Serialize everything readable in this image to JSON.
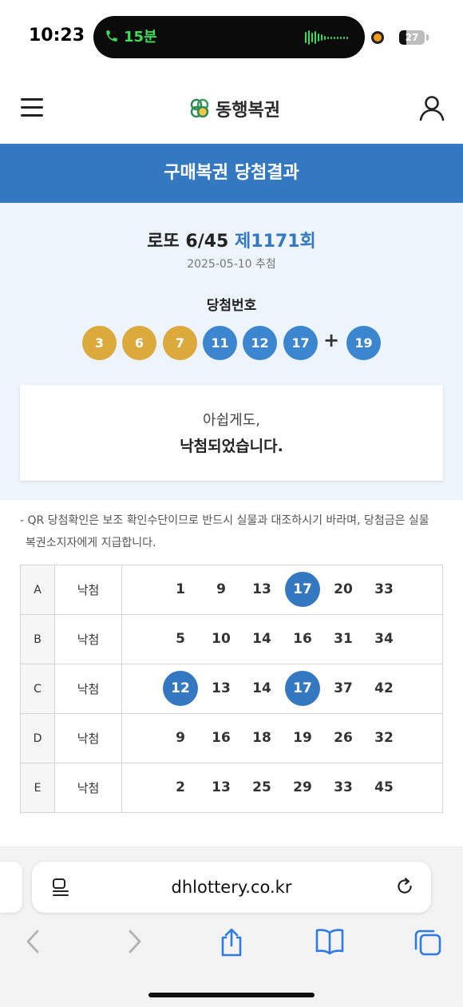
{
  "status_bar": {
    "time": "10:23",
    "call_duration": "15분",
    "battery_level": "27",
    "battery_fraction": 0.27
  },
  "header": {
    "logo_text": "동행복권",
    "menu_icon": "menu-icon",
    "user_icon": "user-icon"
  },
  "page": {
    "title": "구매복권 당첨결과"
  },
  "draw": {
    "game_name": "로또 6/45",
    "round": "제1171회",
    "date": "2025-05-10 추첨",
    "numbers_label": "당첨번호",
    "winning_numbers": [
      "3",
      "6",
      "7",
      "11",
      "12",
      "17"
    ],
    "plus": "+",
    "bonus_number": "19"
  },
  "result_message": {
    "line1": "아쉽게도,",
    "line2": "낙첨되었습니다."
  },
  "notice": {
    "line1": "- QR 당첨확인은 보조 확인수단이므로 반드시 실물과 대조하시기 바라며, 당첨금은 실물",
    "line2": "복권소지자에게 지급합니다."
  },
  "tickets": [
    {
      "game": "A",
      "result": "낙첨",
      "numbers": [
        "1",
        "9",
        "13",
        "17",
        "20",
        "33"
      ],
      "matched": [
        false,
        false,
        false,
        true,
        false,
        false
      ]
    },
    {
      "game": "B",
      "result": "낙첨",
      "numbers": [
        "5",
        "10",
        "14",
        "16",
        "31",
        "34"
      ],
      "matched": [
        false,
        false,
        false,
        false,
        false,
        false
      ]
    },
    {
      "game": "C",
      "result": "낙첨",
      "numbers": [
        "12",
        "13",
        "14",
        "17",
        "37",
        "42"
      ],
      "matched": [
        true,
        false,
        false,
        true,
        false,
        false
      ]
    },
    {
      "game": "D",
      "result": "낙첨",
      "numbers": [
        "9",
        "16",
        "18",
        "19",
        "26",
        "32"
      ],
      "matched": [
        false,
        false,
        false,
        false,
        false,
        false
      ]
    },
    {
      "game": "E",
      "result": "낙첨",
      "numbers": [
        "2",
        "13",
        "25",
        "29",
        "33",
        "45"
      ],
      "matched": [
        false,
        false,
        false,
        false,
        false,
        false
      ]
    }
  ],
  "browser": {
    "url": "dhlottery.co.kr"
  },
  "colors": {
    "accent_blue": "#3478c2",
    "ball_yellow": "#dba93c",
    "ball_blue": "#3c86cf",
    "call_green": "#3fdc5a"
  }
}
